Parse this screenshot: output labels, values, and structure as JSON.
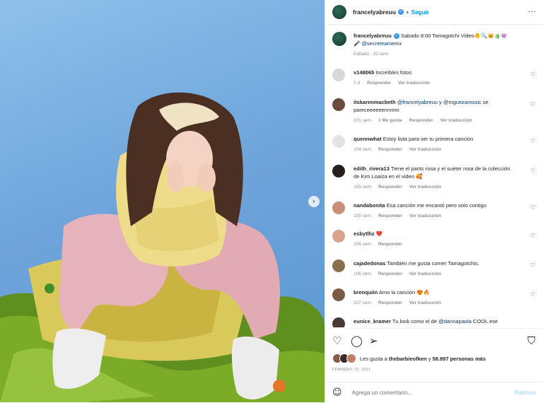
{
  "post": {
    "username": "francelyabreuu",
    "follow_label": "Seguir",
    "more_label": "···",
    "caption_text": "Sabado 8:00 Tamagotchi Video🐥🔍😺🧃👾",
    "caption_line2_emoji": "🎤",
    "caption_mention": "@secretnamemx",
    "caption_meta": "Editado · 32 sem"
  },
  "comments": [
    {
      "user": "v148065",
      "text": "Increíbles fotos",
      "time": "1 d",
      "likes": "",
      "reply": "Responder",
      "translate": "Ver traducción",
      "avatar_color": "#d8d8d8"
    },
    {
      "user": "itskarenmacbeth",
      "text_mention1": "@francelyabreuu",
      "text_join": " y ",
      "text_mention2": "@mguezamusic",
      "text_rest": " se pareceeeeeennnnn",
      "time": "101 sem",
      "likes": "1 Me gusta",
      "reply": "Responder",
      "translate": "Ver traducción",
      "avatar_color": "#6b4b3e"
    },
    {
      "user": "quennwhat",
      "text": "Estoy lista para ver tu primera canción",
      "time": "104 sem",
      "likes": "",
      "reply": "Responder",
      "translate": "Ver traducción",
      "avatar_color": "#e3e3e3"
    },
    {
      "user": "edith_rivera13",
      "text": "Tiene el pants rosa y el suéter rosa de la colección de Kim Loaiza en el video 🥰",
      "time": "105 sem",
      "likes": "",
      "reply": "Responder",
      "translate": "Ver traducción",
      "avatar_color": "#2a1f1f"
    },
    {
      "user": "nandabonita",
      "text": "Esa canción me encantó pero solo contigo",
      "time": "105 sem",
      "likes": "",
      "reply": "Responder",
      "translate": "Ver traducción",
      "avatar_color": "#c98f7a"
    },
    {
      "user": "esbytlliz",
      "text": "❤️",
      "time": "106 sem",
      "likes": "",
      "reply": "Responder",
      "translate": "",
      "avatar_color": "#d9a38c"
    },
    {
      "user": "cajadedonas",
      "text": "También me gusta comer Tamagotchis.",
      "time": "106 sem",
      "likes": "",
      "reply": "Responder",
      "translate": "Ver traducción",
      "avatar_color": "#8a6f4e"
    },
    {
      "user": "brenquiin",
      "text": "Amo la canción 😍🔥",
      "time": "107 sem",
      "likes": "",
      "reply": "Responder",
      "translate": "Ver traducción",
      "avatar_color": "#7d5a48"
    },
    {
      "user": "eunice_kramer",
      "text": "Tu look como el de",
      "text_mention1": "@dannapaola",
      "text_rest": " COOL ese",
      "time": "",
      "likes": "",
      "reply": "",
      "translate": "",
      "avatar_color": "#4a3a35"
    }
  ],
  "likes": {
    "prefix": "Les gusta a ",
    "user": "thebarbieofken",
    "suffix": " y ",
    "count": "58.897 personas más"
  },
  "date": "FEBRERO 19, 2021",
  "add_comment": {
    "placeholder": "Agrega un comentario...",
    "post_label": "Publicar"
  },
  "colors": {
    "accent": "#0095f6",
    "mention": "#00376b",
    "muted": "#8e8e8e"
  }
}
